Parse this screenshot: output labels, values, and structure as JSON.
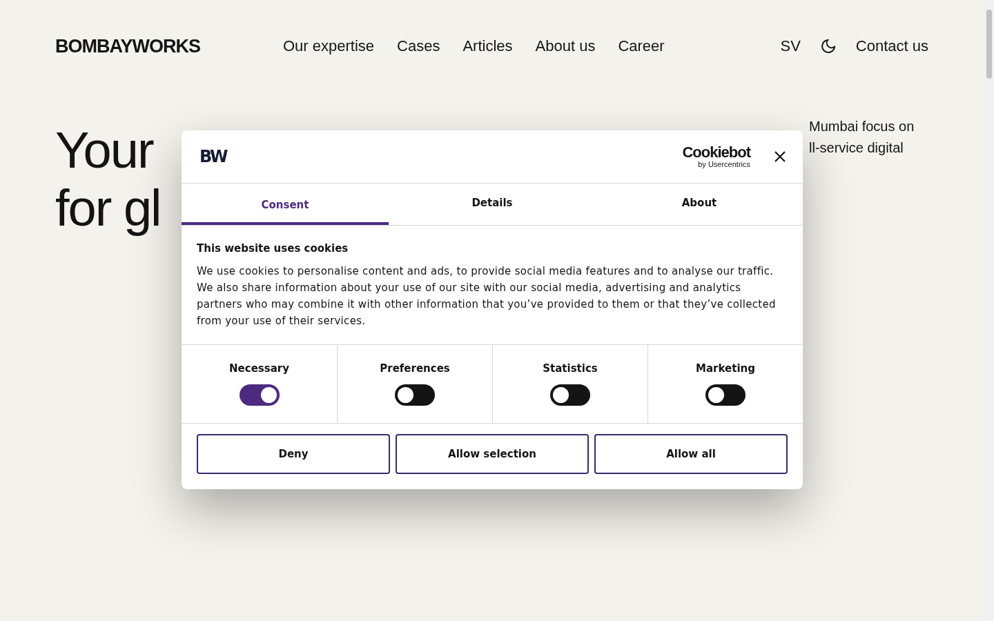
{
  "header": {
    "logo": "BOMBAYWORKS",
    "nav": [
      "Our expertise",
      "Cases",
      "Articles",
      "About us",
      "Career"
    ],
    "language": "SV",
    "contact": "Contact us"
  },
  "hero": {
    "title_lines": [
      "Your",
      "for gl"
    ],
    "intro_lines": [
      "Mumbai focus on",
      "ll-service digital"
    ]
  },
  "dialog": {
    "logo": "BW",
    "brand": "Cookiebot",
    "brand_sub": "by Usercentrics",
    "tabs": [
      {
        "label": "Consent",
        "selected": true
      },
      {
        "label": "Details",
        "selected": false
      },
      {
        "label": "About",
        "selected": false
      }
    ],
    "heading": "This website uses cookies",
    "body": "We use cookies to personalise content and ads, to provide social media features and to analyse our traffic. We also share information about your use of our site with our social media, advertising and analytics partners who may combine it with other information that you’ve provided to them or that they’ve collected from your use of their services.",
    "categories": [
      {
        "label": "Necessary",
        "on": true
      },
      {
        "label": "Preferences",
        "on": false
      },
      {
        "label": "Statistics",
        "on": false
      },
      {
        "label": "Marketing",
        "on": false
      }
    ],
    "buttons": [
      "Deny",
      "Allow selection",
      "Allow all"
    ]
  }
}
